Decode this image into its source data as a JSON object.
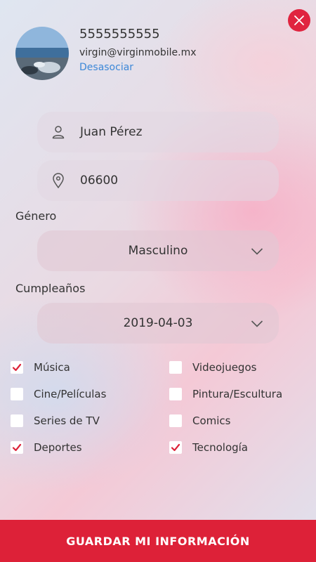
{
  "profile": {
    "phone": "5555555555",
    "email": "virgin@virginmobile.mx",
    "unlink_label": "Desasociar"
  },
  "form": {
    "name": "Juan Pérez",
    "postal_code": "06600",
    "gender_label": "Género",
    "gender_value": "Masculino",
    "birthday_label": "Cumpleaños",
    "birthday_value": "2019-04-03"
  },
  "interests": [
    {
      "label": "Música",
      "checked": true
    },
    {
      "label": "Videojuegos",
      "checked": false
    },
    {
      "label": "Cine/Películas",
      "checked": false
    },
    {
      "label": "Pintura/Escultura",
      "checked": false
    },
    {
      "label": "Series de TV",
      "checked": false
    },
    {
      "label": "Comics",
      "checked": false
    },
    {
      "label": "Deportes",
      "checked": true
    },
    {
      "label": "Tecnología",
      "checked": true
    }
  ],
  "save_label": "GUARDAR MI INFORMACIÓN",
  "colors": {
    "accent": "#dd2138",
    "link": "#3d88d8"
  }
}
